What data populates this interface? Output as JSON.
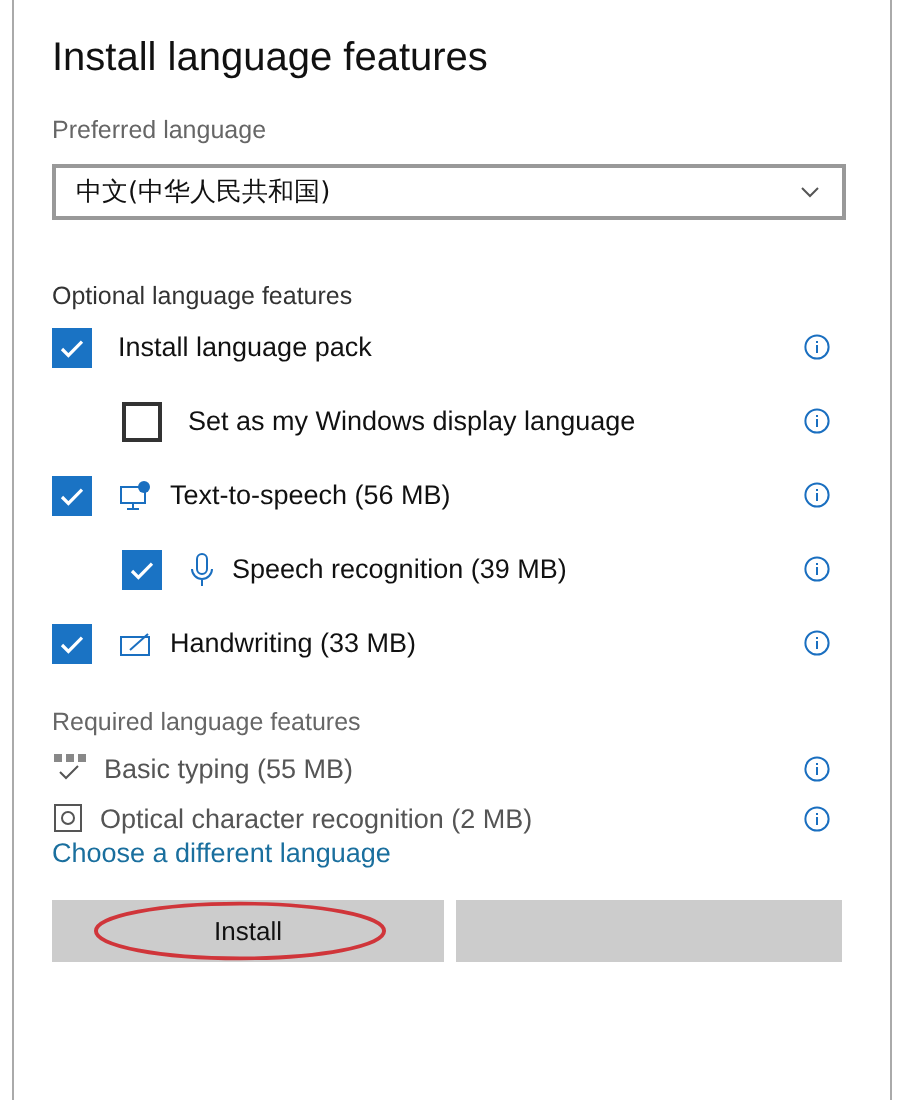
{
  "window": {
    "title": "Install language features"
  },
  "preferred_language": {
    "label": "Preferred language",
    "value": "中文(中华人民共和国)"
  },
  "optional": {
    "heading": "Optional language features",
    "items": [
      {
        "label": "Install language pack",
        "checked": true,
        "kind": "plain",
        "children": [
          {
            "label": "Set as my Windows display language",
            "checked": false,
            "kind": "plain"
          }
        ]
      },
      {
        "label": "Text-to-speech (56 MB)",
        "checked": true,
        "kind": "speech",
        "children": [
          {
            "label": "Speech recognition (39 MB)",
            "checked": true,
            "kind": "voice"
          }
        ]
      },
      {
        "label": "Handwriting (33 MB)",
        "checked": true,
        "kind": "handwriting"
      }
    ]
  },
  "required": {
    "heading": "Required language features",
    "items": [
      {
        "label": "Basic typing (55 MB)",
        "kind": "typing"
      },
      {
        "label": "Optical character recognition (2 MB)",
        "kind": "ocr"
      }
    ]
  },
  "link": "Choose a different language",
  "buttons": [
    {
      "kind": "labeled",
      "label": "Install",
      "highlighted": true
    },
    {
      "kind": "blank"
    }
  ]
}
